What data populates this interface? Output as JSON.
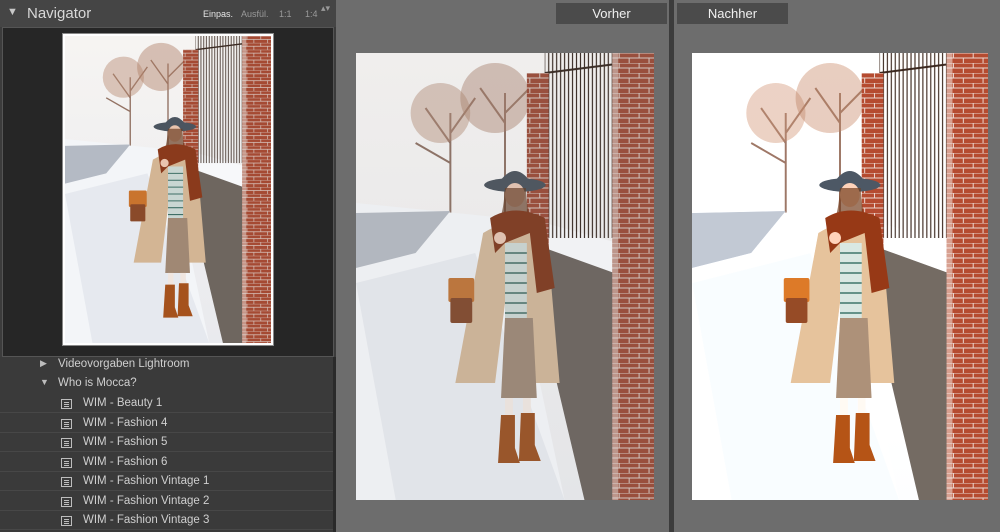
{
  "navigator": {
    "collapse_icon": "▼",
    "title": "Navigator",
    "zoom_options": [
      {
        "label": "Einpas.",
        "active": true
      },
      {
        "label": "Ausfül.",
        "active": false
      },
      {
        "label": "1:1",
        "active": false
      },
      {
        "label": "1:4",
        "active": false
      }
    ],
    "zoom_arrows": "▴▾"
  },
  "collections": {
    "rows": [
      {
        "label": "Videovorgaben Lightroom",
        "type": "folder-collapsed"
      },
      {
        "label": "Who is Mocca?",
        "type": "folder-expanded"
      }
    ],
    "items": [
      "WIM - Beauty 1",
      "WIM - Fashion 4",
      "WIM - Fashion 5",
      "WIM - Fashion 6",
      "WIM - Fashion Vintage 1",
      "WIM - Fashion Vintage 2",
      "WIM - Fashion Vintage 3"
    ]
  },
  "compare": {
    "before_label": "Vorher",
    "after_label": "Nachher"
  },
  "colors": {
    "panel_bg": "#3c3c3c",
    "workspace_bg": "#6d6d6d",
    "brick": "#9a4630",
    "coat": "#d3b594",
    "scarf": "#8a3a1c",
    "snow": "#f3f5f8"
  }
}
